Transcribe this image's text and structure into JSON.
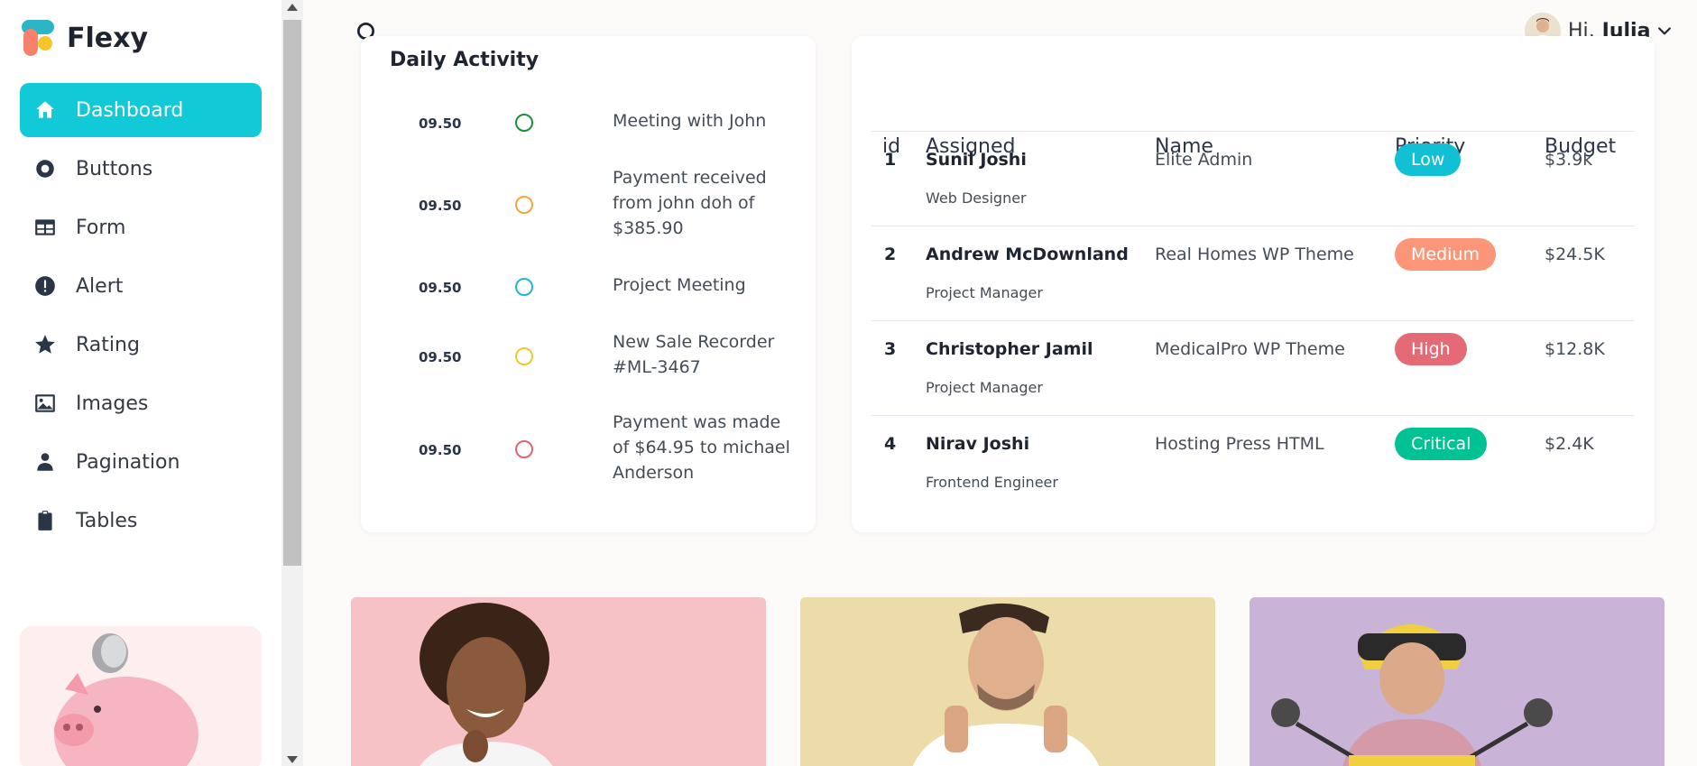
{
  "brand": {
    "name": "Flexy"
  },
  "sidebar": {
    "items": [
      {
        "label": "Dashboard",
        "icon": "home-icon",
        "active": true
      },
      {
        "label": "Buttons",
        "icon": "radio-button-icon"
      },
      {
        "label": "Form",
        "icon": "table-form-icon"
      },
      {
        "label": "Alert",
        "icon": "alert-circle-icon"
      },
      {
        "label": "Rating",
        "icon": "star-icon"
      },
      {
        "label": "Images",
        "icon": "image-icon"
      },
      {
        "label": "Pagination",
        "icon": "person-icon"
      },
      {
        "label": "Tables",
        "icon": "clipboard-icon"
      }
    ]
  },
  "header": {
    "greeting": "Hi,",
    "user_name": "Julia"
  },
  "activity": {
    "title": "Daily Activity",
    "items": [
      {
        "time": "09.50",
        "text": "Meeting with John",
        "color": "#1a8f3c"
      },
      {
        "time": "09.50",
        "text": "Payment received from john doh of $385.90",
        "color": "#f7a43b"
      },
      {
        "time": "09.50",
        "text": "Project Meeting",
        "color": "#21b6d3"
      },
      {
        "time": "09.50",
        "text": "New Sale Recorder #ML-3467",
        "color": "#f5c52a"
      },
      {
        "time": "09.50",
        "text": "Payment was made of $64.95 to michael Anderson",
        "color": "#e06474"
      }
    ]
  },
  "table": {
    "columns": [
      "id",
      "Assigned",
      "Name",
      "Priority",
      "Budget"
    ],
    "rows": [
      {
        "id": "1",
        "assigned": "Sunil Joshi",
        "role": "Web Designer",
        "name": "Elite Admin",
        "priority": "Low",
        "priority_color": "#12c0d6",
        "budget": "$3.9k"
      },
      {
        "id": "2",
        "assigned": "Andrew McDownland",
        "role": "Project Manager",
        "name": "Real Homes WP Theme",
        "priority": "Medium",
        "priority_color": "#fb9678",
        "budget": "$24.5K"
      },
      {
        "id": "3",
        "assigned": "Christopher Jamil",
        "role": "Project Manager",
        "name": "MedicalPro WP Theme",
        "priority": "High",
        "priority_color": "#e46a76",
        "budget": "$12.8K"
      },
      {
        "id": "4",
        "assigned": "Nirav Joshi",
        "role": "Frontend Engineer",
        "name": "Hosting Press HTML",
        "priority": "Critical",
        "priority_color": "#00c292",
        "budget": "$2.4K"
      }
    ]
  },
  "photos": [
    {
      "subject": "smiling woman on pink background",
      "bg": "#f6c2c6"
    },
    {
      "subject": "man giving thumbs up on yellow background",
      "bg": "#ecdcaa"
    },
    {
      "subject": "man on scooter with helmet on purple background",
      "bg": "#c9b3d6"
    }
  ],
  "colors": {
    "accent": "#12c9d8"
  }
}
